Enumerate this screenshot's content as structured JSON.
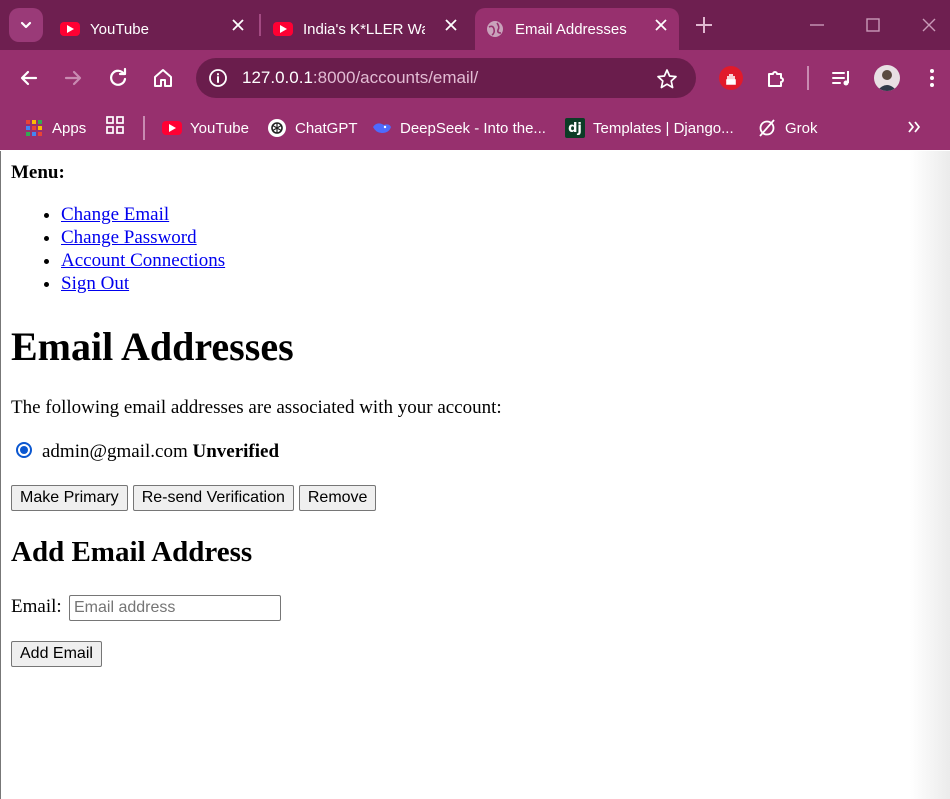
{
  "browser": {
    "tabs": [
      {
        "title": "YouTube",
        "active": false
      },
      {
        "title": "India's K*LLER War",
        "active": false
      },
      {
        "title": "Email Addresses",
        "active": true
      }
    ],
    "url_host": "127.0.0.1",
    "url_path": ":8000/accounts/email/",
    "bookmarks": [
      {
        "label": "Apps",
        "icon": "apps-grid-icon"
      },
      {
        "label": "YouTube",
        "icon": "youtube-icon"
      },
      {
        "label": "ChatGPT",
        "icon": "chatgpt-icon"
      },
      {
        "label": "DeepSeek - Into the...",
        "icon": "deepseek-icon"
      },
      {
        "label": "Templates | Django...",
        "icon": "django-icon"
      },
      {
        "label": "Grok",
        "icon": "grok-icon"
      }
    ],
    "colors": {
      "frame": "#6e1f50",
      "toolbar": "#97306e",
      "accent": "#ff0033"
    }
  },
  "page": {
    "menu_title": "Menu:",
    "menu_links": [
      "Change Email",
      "Change Password",
      "Account Connections",
      "Sign Out"
    ],
    "heading": "Email Addresses",
    "intro": "The following email addresses are associated with your account:",
    "emails": [
      {
        "address": "admin@gmail.com",
        "status": "Unverified",
        "selected": true
      }
    ],
    "actions": {
      "make_primary": "Make Primary",
      "resend": "Re-send Verification",
      "remove": "Remove"
    },
    "add_heading": "Add Email Address",
    "email_label": "Email:",
    "email_placeholder": "Email address",
    "email_value": "",
    "add_button": "Add Email",
    "link_color": "#0000ee"
  }
}
